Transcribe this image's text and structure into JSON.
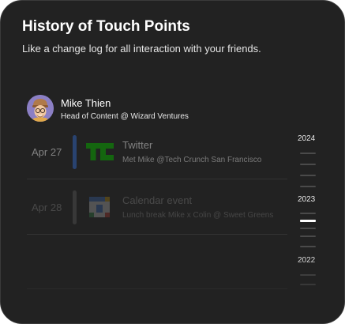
{
  "header": {
    "title": "History of Touch Points",
    "subtitle": "Like a change log for all interaction with your friends."
  },
  "person": {
    "name": "Mike Thien",
    "role": "Head of Content @ Wizard Ventures",
    "avatar_icon": "memoji-avatar"
  },
  "entries": [
    {
      "date": "Apr 27",
      "title": "Twitter",
      "description": "Met Mike @Tech Crunch San Francisco",
      "icon": "techcrunch-logo",
      "accent": "#2f5fb0"
    },
    {
      "date": "Apr 28",
      "title": "Calendar event",
      "description": "Lunch break Mike x Colin @ Sweet Greens",
      "icon": "google-calendar-logo",
      "accent": "#3a3a3a"
    }
  ],
  "timeline": {
    "years": [
      "2024",
      "2023",
      "2022"
    ],
    "active_year": "2023"
  },
  "colors": {
    "background": "#222222",
    "text": "#ffffff",
    "techcrunch_green": "#0a9e01"
  }
}
